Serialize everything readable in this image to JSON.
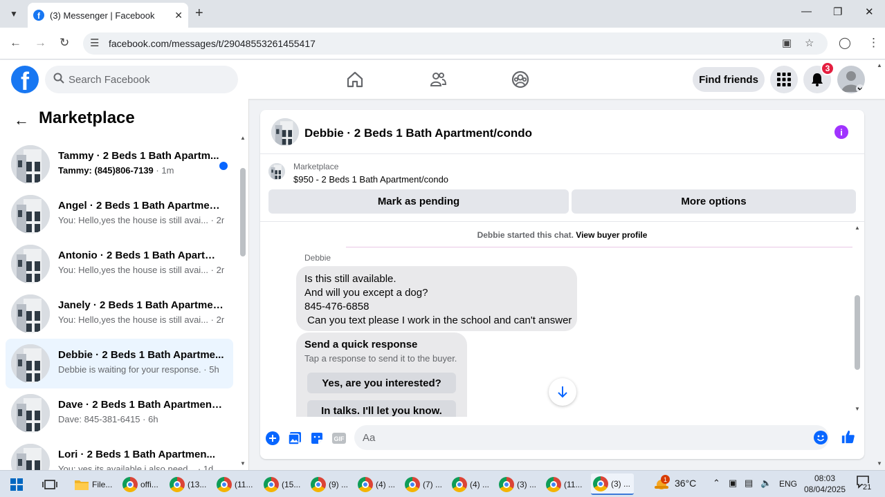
{
  "browser": {
    "tab_title": "(3) Messenger | Facebook",
    "url": "facebook.com/messages/t/29048553261455417"
  },
  "header": {
    "search_placeholder": "Search Facebook",
    "find_friends": "Find friends",
    "notification_count": "3"
  },
  "sidebar": {
    "title": "Marketplace",
    "conversations": [
      {
        "name": "Tammy · 2 Beds 1 Bath Apartm...",
        "preview": "Tammy: (845)806-7139",
        "time": " · 1m",
        "unread": true
      },
      {
        "name": "Angel · 2 Beds 1 Bath Apartment...",
        "preview": "You: Hello,yes the house is still avai...",
        "time": " · 2m"
      },
      {
        "name": "Antonio · 2 Beds 1 Bath Apartme...",
        "preview": "You: Hello,yes the house is still avai...",
        "time": " · 2m"
      },
      {
        "name": "Janely · 2 Beds 1 Bath Apartmen...",
        "preview": "You: Hello,yes the house is still avai...",
        "time": " · 2m"
      },
      {
        "name": "Debbie · 2 Beds 1 Bath Apartme...",
        "preview": "Debbie is waiting for your response.",
        "time": " · 5h",
        "active": true
      },
      {
        "name": "Dave · 2 Beds 1 Bath Apartment/...",
        "preview": "Dave: 845-381-6415",
        "time": " · 6h"
      },
      {
        "name": "Lori · 2 Beds 1 Bath Apartmen...",
        "preview": "You: yes its available i also need...",
        "time": " · 1d"
      }
    ]
  },
  "chat": {
    "title": "Debbie · 2 Beds 1 Bath Apartment/condo",
    "marketplace_label": "Marketplace",
    "listing": "$950 - 2 Beds 1 Bath Apartment/condo",
    "mark_pending": "Mark as pending",
    "more_options": "More options",
    "started_text": "Debbie started this chat.",
    "view_profile": "View buyer profile",
    "sender": "Debbie",
    "message_lines": [
      "Is this still available.",
      "And will you except a dog?",
      "845-476-6858",
      " Can you text please I work in the school and can't answer"
    ],
    "quick_title": "Send a quick response",
    "quick_sub": "Tap a response to send it to the buyer.",
    "quick_replies": [
      "Yes, are you interested?",
      "In talks. I'll let you know."
    ],
    "composer_placeholder": "Aa"
  },
  "taskbar": {
    "items": [
      "File...",
      "offi...",
      "(13...",
      "(11...",
      "(15...",
      "(9) ...",
      "(4) ...",
      "(7) ...",
      "(4) ...",
      "(3) ...",
      "(11...",
      "(3) ..."
    ],
    "weather_badge": "1",
    "temperature": "36°C",
    "language": "ENG",
    "time": "08:03",
    "date": "08/04/2025",
    "notification_count": "21"
  }
}
